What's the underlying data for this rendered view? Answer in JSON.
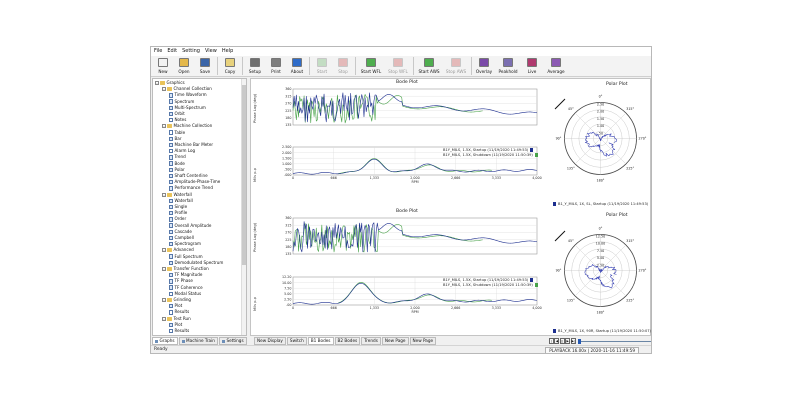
{
  "menu": [
    "File",
    "Edit",
    "Setting",
    "View",
    "Help"
  ],
  "toolbar": [
    {
      "label": "New",
      "icon": "new-icon",
      "color": "#f2f2f2",
      "enabled": true
    },
    {
      "label": "Open",
      "icon": "open-folder-icon",
      "color": "#e4b84b",
      "enabled": true
    },
    {
      "label": "Save",
      "icon": "save-icon",
      "color": "#3b65a8",
      "enabled": true
    },
    {
      "sep": true
    },
    {
      "label": "Copy",
      "icon": "copy-icon",
      "color": "#e8d27d",
      "enabled": true
    },
    {
      "sep": true
    },
    {
      "label": "Setup",
      "icon": "setup-icon",
      "color": "#6f6f6f",
      "enabled": true
    },
    {
      "label": "Print",
      "icon": "print-icon",
      "color": "#7e7e7e",
      "enabled": true
    },
    {
      "label": "About",
      "icon": "about-icon",
      "color": "#2f6cc9",
      "enabled": true
    },
    {
      "sep": true
    },
    {
      "label": "Start",
      "icon": "start-icon",
      "color": "#6bb56b",
      "enabled": false
    },
    {
      "label": "Stop",
      "icon": "stop-icon",
      "color": "#c94f4f",
      "enabled": false
    },
    {
      "sep": true
    },
    {
      "label": "Start WFL",
      "icon": "start-wfl-icon",
      "color": "#4fae4f",
      "enabled": true,
      "wide": true
    },
    {
      "label": "Stop WFL",
      "icon": "stop-wfl-icon",
      "color": "#c94f4f",
      "enabled": false,
      "wide": true
    },
    {
      "sep": true
    },
    {
      "label": "Start AWS",
      "icon": "start-aws-icon",
      "color": "#4fae4f",
      "enabled": true,
      "wide": true
    },
    {
      "label": "Stop AWS",
      "icon": "stop-aws-icon",
      "color": "#c94f4f",
      "enabled": false,
      "wide": true
    },
    {
      "sep": true
    },
    {
      "label": "Overlay",
      "icon": "overlay-icon",
      "color": "#7a4aa8",
      "enabled": true
    },
    {
      "label": "Peakhold",
      "icon": "peakhold-icon",
      "color": "#7b6fb1",
      "enabled": true,
      "wide": true
    },
    {
      "label": "Live",
      "icon": "live-icon",
      "color": "#b03a6f",
      "enabled": true
    },
    {
      "label": "Average",
      "icon": "average-icon",
      "color": "#8b59b3",
      "enabled": true,
      "wide": true
    }
  ],
  "tree": [
    {
      "depth": 0,
      "label": "Graphics",
      "kind": "folder",
      "exp": "-"
    },
    {
      "depth": 1,
      "label": "Channel Collection",
      "kind": "folder",
      "exp": "-"
    },
    {
      "depth": 2,
      "label": "Time Waveform",
      "kind": "chart"
    },
    {
      "depth": 2,
      "label": "Spectrum",
      "kind": "chart"
    },
    {
      "depth": 2,
      "label": "Multi-Spectrum",
      "kind": "chart"
    },
    {
      "depth": 2,
      "label": "Orbit",
      "kind": "chart"
    },
    {
      "depth": 2,
      "label": "Notes",
      "kind": "doc"
    },
    {
      "depth": 1,
      "label": "Machine Collection",
      "kind": "folder",
      "exp": "-"
    },
    {
      "depth": 2,
      "label": "Table",
      "kind": "doc"
    },
    {
      "depth": 2,
      "label": "Bar",
      "kind": "chart"
    },
    {
      "depth": 2,
      "label": "Machine Bar Meter",
      "kind": "chart"
    },
    {
      "depth": 2,
      "label": "Alarm Log",
      "kind": "doc"
    },
    {
      "depth": 2,
      "label": "Trend",
      "kind": "chart"
    },
    {
      "depth": 2,
      "label": "Bode",
      "kind": "chart"
    },
    {
      "depth": 2,
      "label": "Polar",
      "kind": "chart"
    },
    {
      "depth": 2,
      "label": "Shaft Centerline",
      "kind": "chart"
    },
    {
      "depth": 2,
      "label": "Amplitude-Phase-Time",
      "kind": "chart"
    },
    {
      "depth": 2,
      "label": "Performance Trend",
      "kind": "chart"
    },
    {
      "depth": 1,
      "label": "Waterfall",
      "kind": "folder",
      "exp": "-"
    },
    {
      "depth": 2,
      "label": "Waterfall",
      "kind": "chart"
    },
    {
      "depth": 2,
      "label": "Single",
      "kind": "chart"
    },
    {
      "depth": 2,
      "label": "Profile",
      "kind": "chart"
    },
    {
      "depth": 2,
      "label": "Order",
      "kind": "chart"
    },
    {
      "depth": 2,
      "label": "Overall Amplitude",
      "kind": "chart"
    },
    {
      "depth": 2,
      "label": "Cascade",
      "kind": "chart"
    },
    {
      "depth": 2,
      "label": "Campbell",
      "kind": "chart"
    },
    {
      "depth": 2,
      "label": "Spectrogram",
      "kind": "chart"
    },
    {
      "depth": 1,
      "label": "Advanced",
      "kind": "folder",
      "exp": "-"
    },
    {
      "depth": 2,
      "label": "Full Spectrum",
      "kind": "chart"
    },
    {
      "depth": 2,
      "label": "Demodulated Spectrum",
      "kind": "chart"
    },
    {
      "depth": 1,
      "label": "Transfer Function",
      "kind": "folder",
      "exp": "-"
    },
    {
      "depth": 2,
      "label": "TF Magnitude",
      "kind": "chart"
    },
    {
      "depth": 2,
      "label": "TF Phase",
      "kind": "chart"
    },
    {
      "depth": 2,
      "label": "TF Coherence",
      "kind": "chart"
    },
    {
      "depth": 2,
      "label": "Modal Status",
      "kind": "doc"
    },
    {
      "depth": 1,
      "label": "Grinding",
      "kind": "folder",
      "exp": "-"
    },
    {
      "depth": 2,
      "label": "Plot",
      "kind": "chart"
    },
    {
      "depth": 2,
      "label": "Results",
      "kind": "doc"
    },
    {
      "depth": 1,
      "label": "Test Run",
      "kind": "folder",
      "exp": "-"
    },
    {
      "depth": 2,
      "label": "Plot",
      "kind": "chart"
    },
    {
      "depth": 2,
      "label": "Results",
      "kind": "doc"
    }
  ],
  "left_tabs": [
    "Graphs",
    "Machine Train",
    "Settings"
  ],
  "bottom_tabs": [
    "New Display",
    "Switch",
    "B1 Bodes",
    "B2 Bodes",
    "Trends",
    "New Page",
    "New Page"
  ],
  "bottom_tab_active": 2,
  "status": {
    "left": "Ready",
    "right": "PLAYBACK 16.00x | 2020-11-16 11:49:59"
  },
  "playback_position": 0.0,
  "playback_buttons": [
    "|◀",
    "◀",
    "||",
    "▶",
    "▶|"
  ],
  "charts": [
    {
      "title": "Bode Plot",
      "phase": {
        "ylabel": "Phase Lag (deg)",
        "yticks": [
          "360",
          "315",
          "270",
          "225",
          "180",
          "135"
        ]
      },
      "mag": {
        "ylabel": "Mils p-p",
        "yticks": [
          "2.500",
          "2.000",
          "1.500",
          "1.000",
          ".500",
          ".000"
        ],
        "xticks": [
          "0",
          "666",
          "1,333",
          "2,000",
          "2,666",
          "3,333",
          "4,000"
        ],
        "xlabel": "RPM",
        "legend": [
          {
            "text": "B1Y_MILS, 1.5X, Startup (11/19/2020 11:49:53)",
            "color": "#1d2f8f"
          },
          {
            "text": "B1Y_MILS, 1.5X, Shutdown (11/19/2020 11:50:39)",
            "color": "#47a148"
          }
        ]
      }
    },
    {
      "title": "Bode Plot",
      "phase": {
        "ylabel": "Phase Lag (deg)",
        "yticks": [
          "360",
          "315",
          "270",
          "225",
          "180",
          "135"
        ]
      },
      "mag": {
        "ylabel": "Mils p-p",
        "yticks": [
          "12.20",
          "10.00",
          "7.50",
          "5.00",
          "2.50",
          ".00"
        ],
        "xticks": [
          "0",
          "666",
          "1,333",
          "2,000",
          "2,666",
          "3,333",
          "4,000"
        ],
        "xlabel": "RPM",
        "legend": [
          {
            "text": "B1Y_MILS, 1.5X, Startup (11/19/2020 11:49:53)",
            "color": "#1d2f8f"
          },
          {
            "text": "B1Y_MILS, 1.5X, Shutdown (11/19/2020 11:50:39)",
            "color": "#47a148"
          }
        ]
      }
    }
  ],
  "polars": [
    {
      "title": "Polar Plot",
      "rings": [
        "2.50",
        "2.00",
        "1.50",
        "1.00",
        ".50"
      ],
      "angles": [
        "0°",
        "45°",
        "90°",
        "135°",
        "180°",
        "225°",
        "270°",
        "315°"
      ],
      "legend": "B1_Y_MILS, 1X, SL, Startup (11/19/2020 11:49:53)",
      "legend_color": "#1d2f8f"
    },
    {
      "title": "Polar Plot",
      "rings": [
        "12.50",
        "10.00",
        "7.50",
        "5.00",
        "2.50"
      ],
      "angles": [
        "0°",
        "45°",
        "90°",
        "135°",
        "180°",
        "225°",
        "270°",
        "315°"
      ],
      "legend": "B1_Y_MILS, 1X, 90R, Startup (11/19/2020 11:50:07)",
      "legend_color": "#1d2f8f"
    }
  ],
  "colors": {
    "startup": "#1d2f8f",
    "shutdown": "#47a148",
    "grid": "#d8d8d8",
    "polar_line": "#3b45b5"
  }
}
